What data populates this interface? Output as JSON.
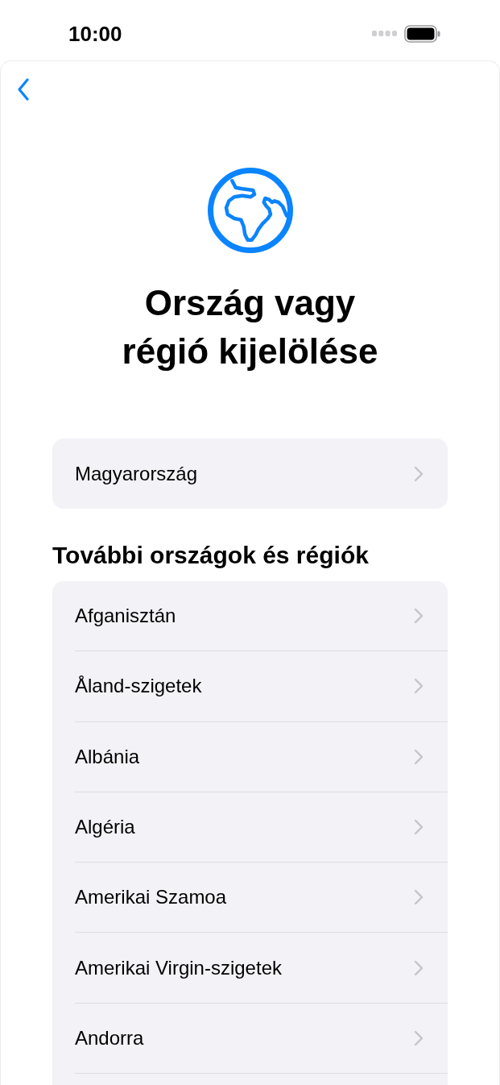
{
  "status_bar": {
    "time": "10:00"
  },
  "header": {
    "title": "Ország vagy régió kijelölése"
  },
  "current_region": {
    "label": "Magyarország"
  },
  "section": {
    "title": "További országok és régiók",
    "items": [
      "Afganisztán",
      "Åland-szigetek",
      "Albánia",
      "Algéria",
      "Amerikai Szamoa",
      "Amerikai Virgin-szigetek",
      "Andorra"
    ]
  }
}
